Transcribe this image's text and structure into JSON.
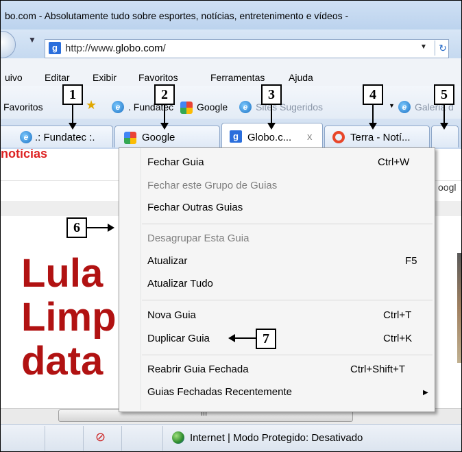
{
  "window": {
    "title": "bo.com - Absolutamente tudo sobre esportes, notícias, entretenimento e vídeos -"
  },
  "address_bar": {
    "url_prefix": "http://www.",
    "url_domain": "globo.com",
    "url_suffix": "/",
    "favicon_letter": "g"
  },
  "menu": [
    "uivo",
    "Editar",
    "Exibir",
    "Favoritos",
    "Ferramentas",
    "Ajuda"
  ],
  "favorites_bar": {
    "label": "Favoritos",
    "items": [
      ". Fundatec",
      "Google",
      "Sites Sugeridos",
      "Galeria d"
    ]
  },
  "tabs": [
    {
      "label": ".: Fundatec :.",
      "icon": "ie-icon"
    },
    {
      "label": "Google",
      "icon": "google-icon"
    },
    {
      "label": "Globo.c...",
      "icon": "globo-icon",
      "close": "x"
    },
    {
      "label": "Terra - Notí...",
      "icon": "terra-icon"
    }
  ],
  "page": {
    "headline_lines": [
      "Lula",
      "Limp",
      "data"
    ],
    "top_text": "notícias",
    "right_text": "oogl",
    "scroll_grip": "III"
  },
  "context_menu": {
    "items": [
      {
        "label": "Fechar Guia",
        "shortcut": "Ctrl+W",
        "enabled": true
      },
      {
        "label": "Fechar este Grupo de Guias",
        "shortcut": "",
        "enabled": false
      },
      {
        "label": "Fechar Outras Guias",
        "shortcut": "",
        "enabled": true
      },
      {
        "label": "Desagrupar Esta Guia",
        "shortcut": "",
        "enabled": false
      },
      {
        "label": "Atualizar",
        "shortcut": "F5",
        "enabled": true
      },
      {
        "label": "Atualizar Tudo",
        "shortcut": "",
        "enabled": true
      },
      {
        "label": "Nova Guia",
        "shortcut": "Ctrl+T",
        "enabled": true
      },
      {
        "label": "Duplicar Guia",
        "shortcut": "Ctrl+K",
        "enabled": true
      },
      {
        "label": "Reabrir Guia Fechada",
        "shortcut": "Ctrl+Shift+T",
        "enabled": true
      },
      {
        "label": "Guias Fechadas Recentemente",
        "shortcut": "",
        "enabled": true
      }
    ]
  },
  "status_bar": {
    "zone_text": "Internet | Modo Protegido: Desativado"
  },
  "callouts": [
    "1",
    "2",
    "3",
    "4",
    "5",
    "6",
    "7"
  ]
}
